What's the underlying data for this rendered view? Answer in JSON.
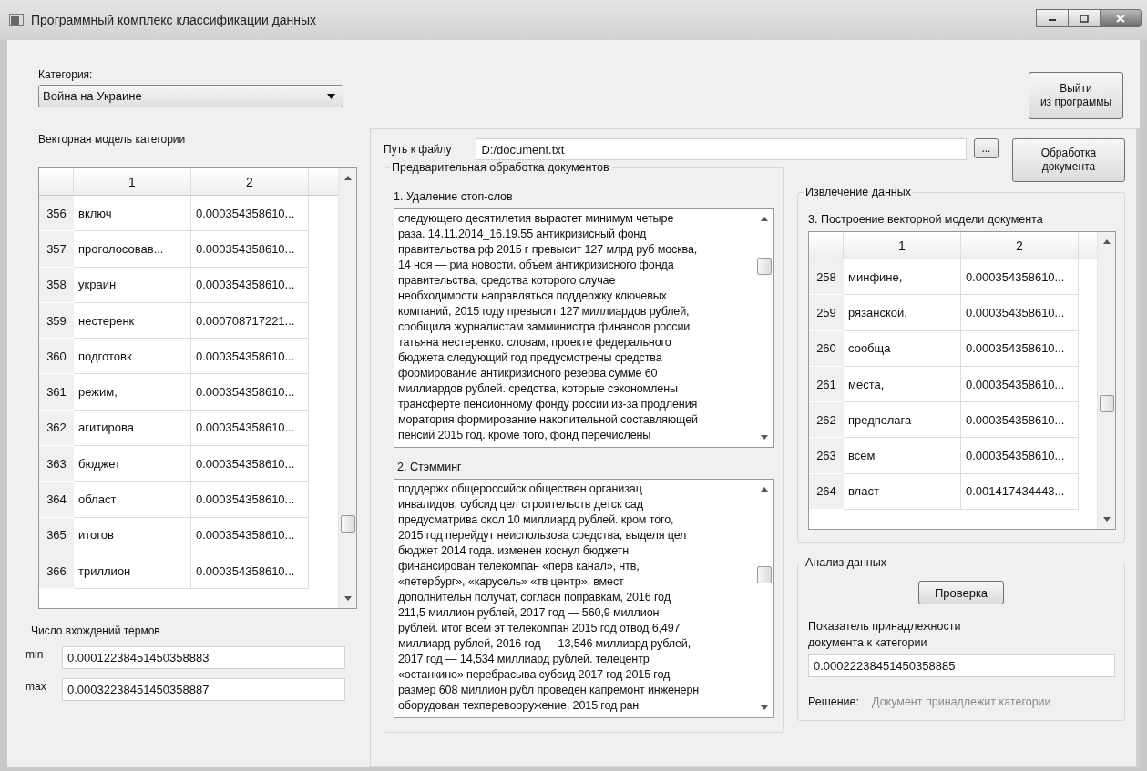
{
  "window": {
    "title": "Программный комплекс классификации данных"
  },
  "category": {
    "label": "Категория:",
    "value": "Война на Украине"
  },
  "exit_button": [
    "Выйти",
    "из программы"
  ],
  "category_model": {
    "title": "Векторная модель категории",
    "columns": [
      "1",
      "2"
    ],
    "rows": [
      {
        "index": "356",
        "term": "включ",
        "weight": "0.000354358610..."
      },
      {
        "index": "357",
        "term": "проголосовав...",
        "weight": "0.000354358610..."
      },
      {
        "index": "358",
        "term": "украин",
        "weight": "0.000354358610..."
      },
      {
        "index": "359",
        "term": "нестеренк",
        "weight": "0.000708717221..."
      },
      {
        "index": "360",
        "term": "подготовк",
        "weight": "0.000354358610..."
      },
      {
        "index": "361",
        "term": "режим,",
        "weight": "0.000354358610..."
      },
      {
        "index": "362",
        "term": "агитирова",
        "weight": "0.000354358610..."
      },
      {
        "index": "363",
        "term": "бюджет",
        "weight": "0.000354358610..."
      },
      {
        "index": "364",
        "term": "област",
        "weight": "0.000354358610..."
      },
      {
        "index": "365",
        "term": "итогов",
        "weight": "0.000354358610..."
      },
      {
        "index": "366",
        "term": "триллион",
        "weight": "0.000354358610..."
      }
    ]
  },
  "term_counts": {
    "title": "Число вхождений термов",
    "min": {
      "label": "min",
      "value": "0.00012238451450358883"
    },
    "max": {
      "label": "max",
      "value": "0.00032238451450358887"
    }
  },
  "file_path": {
    "label": "Путь к файлу",
    "value": "D:/document.txt",
    "browse_button": "...",
    "process_button": [
      "Обработка",
      "документа"
    ]
  },
  "preprocessing": {
    "title": "Предварительная обработка документов",
    "stop_words": {
      "label": "1. Удаление стоп-слов",
      "lines": [
        "следующего десятилетия вырастет минимум четыре",
        "раза. 14.11.2014_16.19.55 антикризисный фонд",
        "правительства рф 2015 г превысит 127 млрд руб москва,",
        "14 ноя — риа новости. объем антикризисного фонда",
        "правительства, средства которого случае",
        "необходимости направляться поддержку ключевых",
        "компаний, 2015 году превысит 127 миллиардов рублей,",
        "сообщила журналистам замминистра финансов россии",
        "татьяна нестеренко. словам, проекте федерального",
        "бюджета следующий год предусмотрены средства",
        "формирование антикризисного резерва сумме 60",
        "миллиардов рублей. средства, которые сэкономлены",
        "трансферте пенсионному фонду россии из-за продления",
        "моратория формирование накопительной составляющей",
        "пенсий 2015 год. кроме того, фонд перечислены"
      ]
    },
    "stemming": {
      "label": "2. Стэмминг",
      "lines": [
        "поддержк общероссийск обществен организац",
        "инвалидов. субсид цел строительств детск сад",
        "предусматрива окол 10 миллиард рублей. кром того,",
        "2015 год перейдут неиспользова средства, выделя цел",
        "бюджет 2014 года. изменен коснул бюджетн",
        "финансирован телекомпан «перв канал», нтв,",
        "«петербург», «карусель» «тв центр». вмест",
        "дополнительн получат, согласн поправкам, 2016 год",
        "211,5 миллион рублей, 2017 год — 560,9 миллион",
        "рублей. итог всем эт телекомпан 2015 год отвод 6,497",
        "миллиард рублей, 2016 год — 13,546 миллиард рублей,",
        "2017 год — 14,534 миллиард рублей. телецентр",
        "«останкино» перебрасыва субсид 2017 год 2015 год",
        "размер 608 миллион рубл проведен капремонт инженерн",
        "оборудован техперевооружение. 2015 год ран"
      ]
    }
  },
  "extraction": {
    "title": "Извлечение данных",
    "table": {
      "title": "3. Построение векторной модели документа",
      "columns": [
        "1",
        "2"
      ],
      "rows": [
        {
          "index": "258",
          "term": "минфине,",
          "weight": "0.000354358610..."
        },
        {
          "index": "259",
          "term": "рязанской,",
          "weight": "0.000354358610..."
        },
        {
          "index": "260",
          "term": "сообща",
          "weight": "0.000354358610..."
        },
        {
          "index": "261",
          "term": "места,",
          "weight": "0.000354358610..."
        },
        {
          "index": "262",
          "term": "предполага",
          "weight": "0.000354358610..."
        },
        {
          "index": "263",
          "term": "всем",
          "weight": "0.000354358610..."
        },
        {
          "index": "264",
          "term": "власт",
          "weight": "0.001417434443..."
        }
      ]
    }
  },
  "analysis": {
    "title": "Анализ данных",
    "check_button": "Проверка",
    "score": {
      "label": [
        "Показатель принадлежности",
        "документа к категории"
      ],
      "value": "0.00022238451450358885"
    },
    "decision": {
      "label": "Решение:",
      "value": "Документ принадлежит категории"
    }
  }
}
